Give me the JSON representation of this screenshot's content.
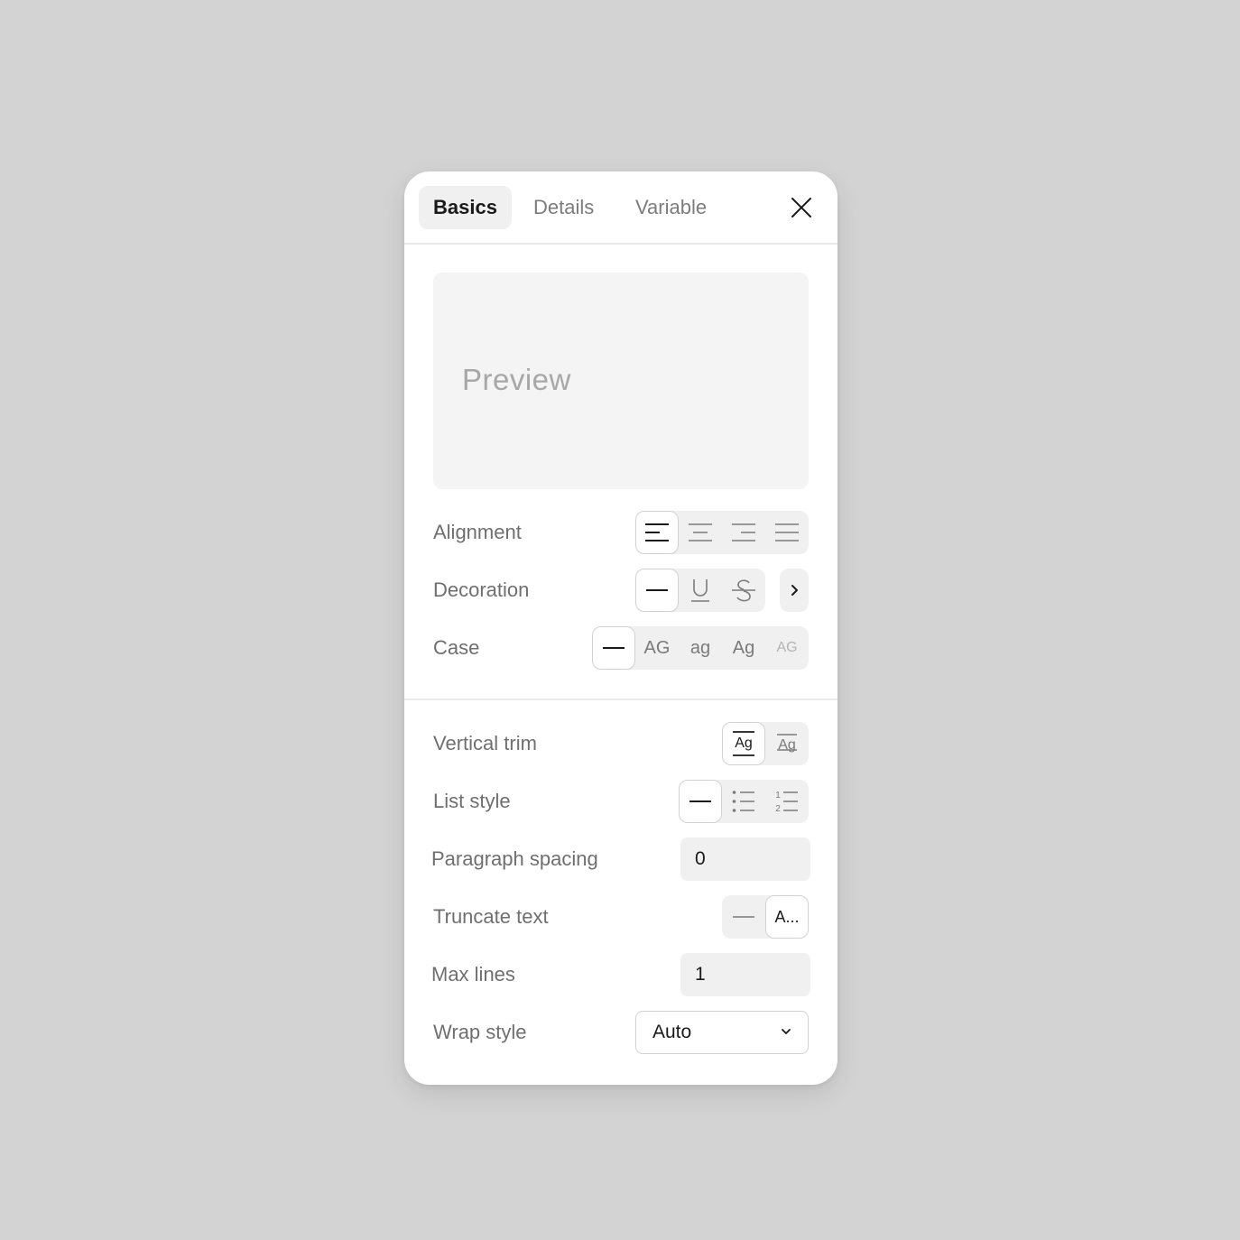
{
  "tabs": [
    {
      "label": "Basics",
      "active": true
    },
    {
      "label": "Details",
      "active": false
    },
    {
      "label": "Variable",
      "active": false
    }
  ],
  "preview": {
    "text": "Preview"
  },
  "basics": {
    "alignment": {
      "label": "Alignment",
      "options": [
        "align-left-icon",
        "align-center-icon",
        "align-right-icon",
        "align-justify-icon"
      ],
      "selected": 0
    },
    "decoration": {
      "label": "Decoration",
      "options": [
        "none-dash-icon",
        "underline-icon",
        "strikethrough-icon"
      ],
      "selected": 0,
      "more": "chevron-right-icon"
    },
    "case": {
      "label": "Case",
      "options": [
        "—",
        "AG",
        "ag",
        "Ag",
        "AG"
      ],
      "selected": 0
    }
  },
  "details": {
    "vertical_trim": {
      "label": "Vertical trim",
      "options": [
        "trim-cap-height-icon",
        "trim-standard-icon"
      ],
      "selected": 0
    },
    "list_style": {
      "label": "List style",
      "options": [
        "none-dash-icon",
        "bulleted-list-icon",
        "numbered-list-icon"
      ],
      "selected": 0
    },
    "paragraph_spacing": {
      "label": "Paragraph spacing",
      "value": "0"
    },
    "truncate_text": {
      "label": "Truncate text",
      "options": [
        "—",
        "A..."
      ],
      "selected": 1
    },
    "max_lines": {
      "label": "Max lines",
      "value": "1"
    },
    "wrap_style": {
      "label": "Wrap style",
      "value": "Auto"
    }
  }
}
